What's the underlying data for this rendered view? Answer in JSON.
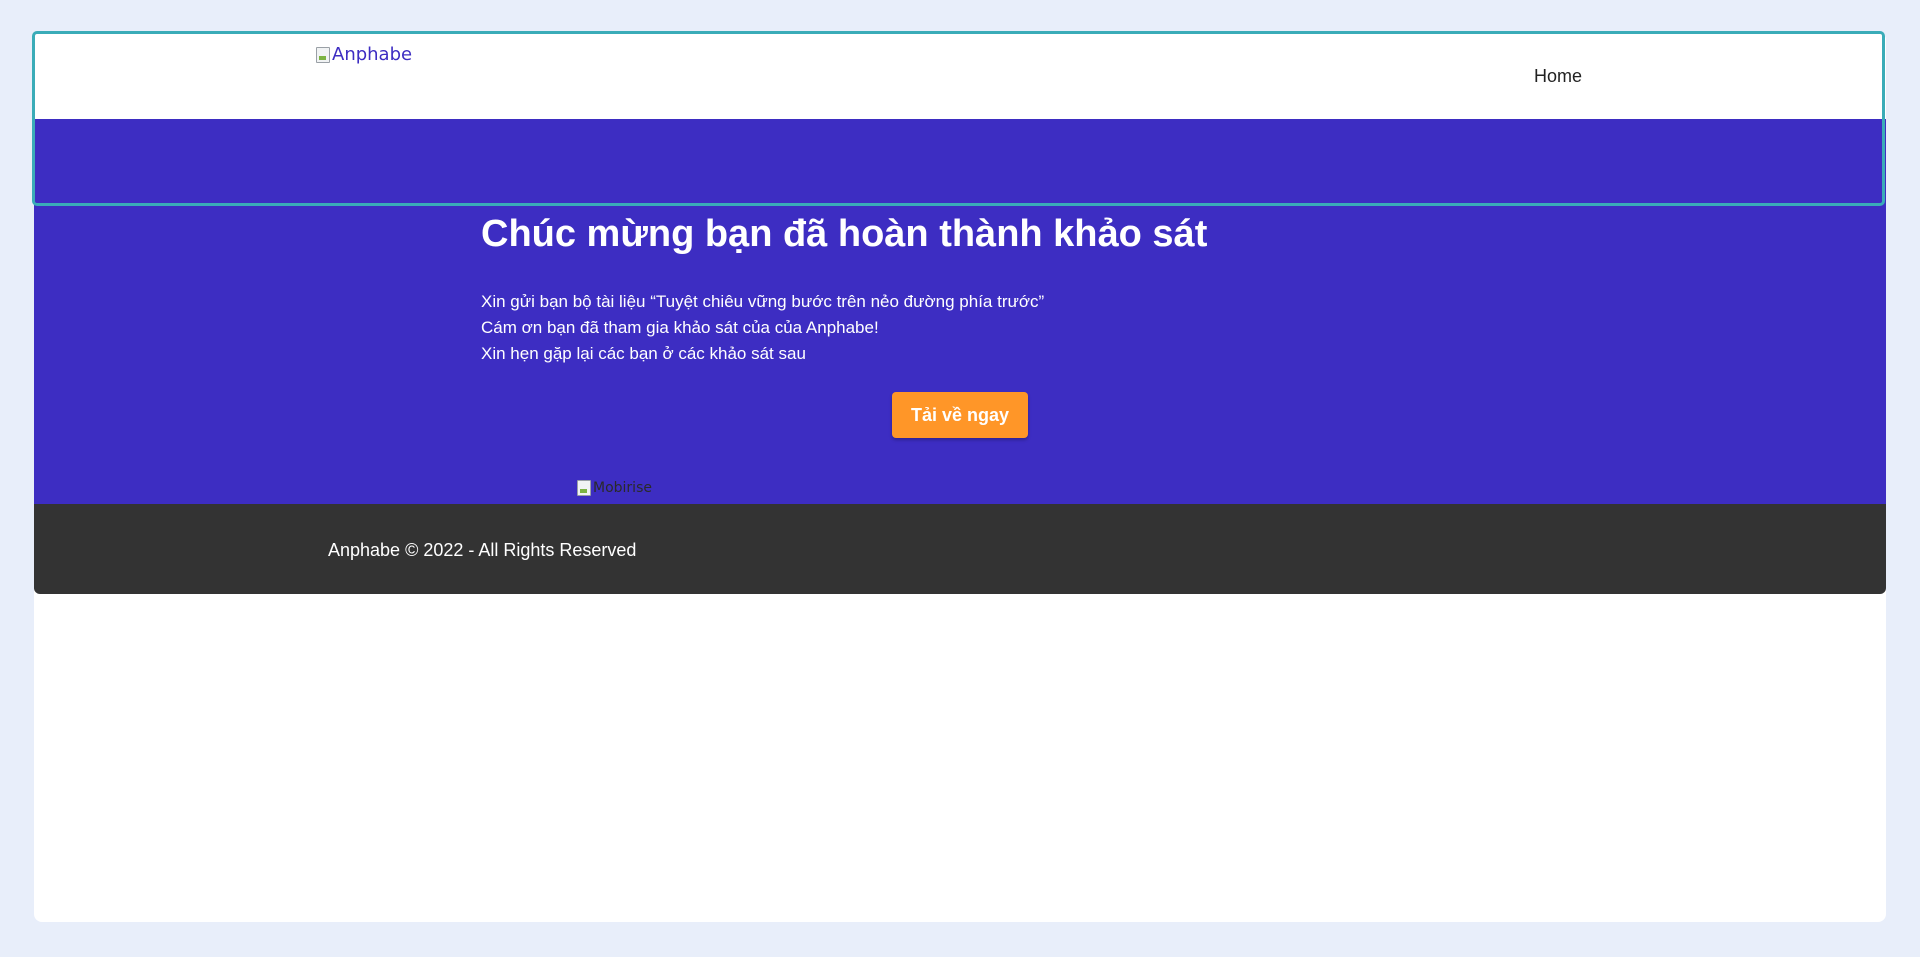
{
  "header": {
    "logo_alt": "Anphabe",
    "nav": {
      "home_label": "Home"
    }
  },
  "hero": {
    "title": "Chúc mừng bạn đã hoàn thành khảo sát",
    "lines": [
      "Xin gửi bạn bộ tài liệu “Tuyệt chiêu vững bước trên nẻo đường phía trước”",
      "Cám ơn bạn đã tham gia khảo sát của của Anphabe!",
      "Xin hẹn gặp lại các bạn ở các khảo sát sau"
    ],
    "button_label": "Tải về ngay",
    "image_alt": "Mobirise"
  },
  "footer": {
    "copyright": "Anphabe © 2022 - All Rights Reserved"
  },
  "colors": {
    "page_background": "#e8eefa",
    "hero_background": "#3d2dc2",
    "button_background": "#ff9628",
    "footer_background": "#333333",
    "focus_outline": "#3aacb8"
  },
  "icons": {
    "logo": "broken-image-icon",
    "mobirise": "broken-image-icon"
  }
}
